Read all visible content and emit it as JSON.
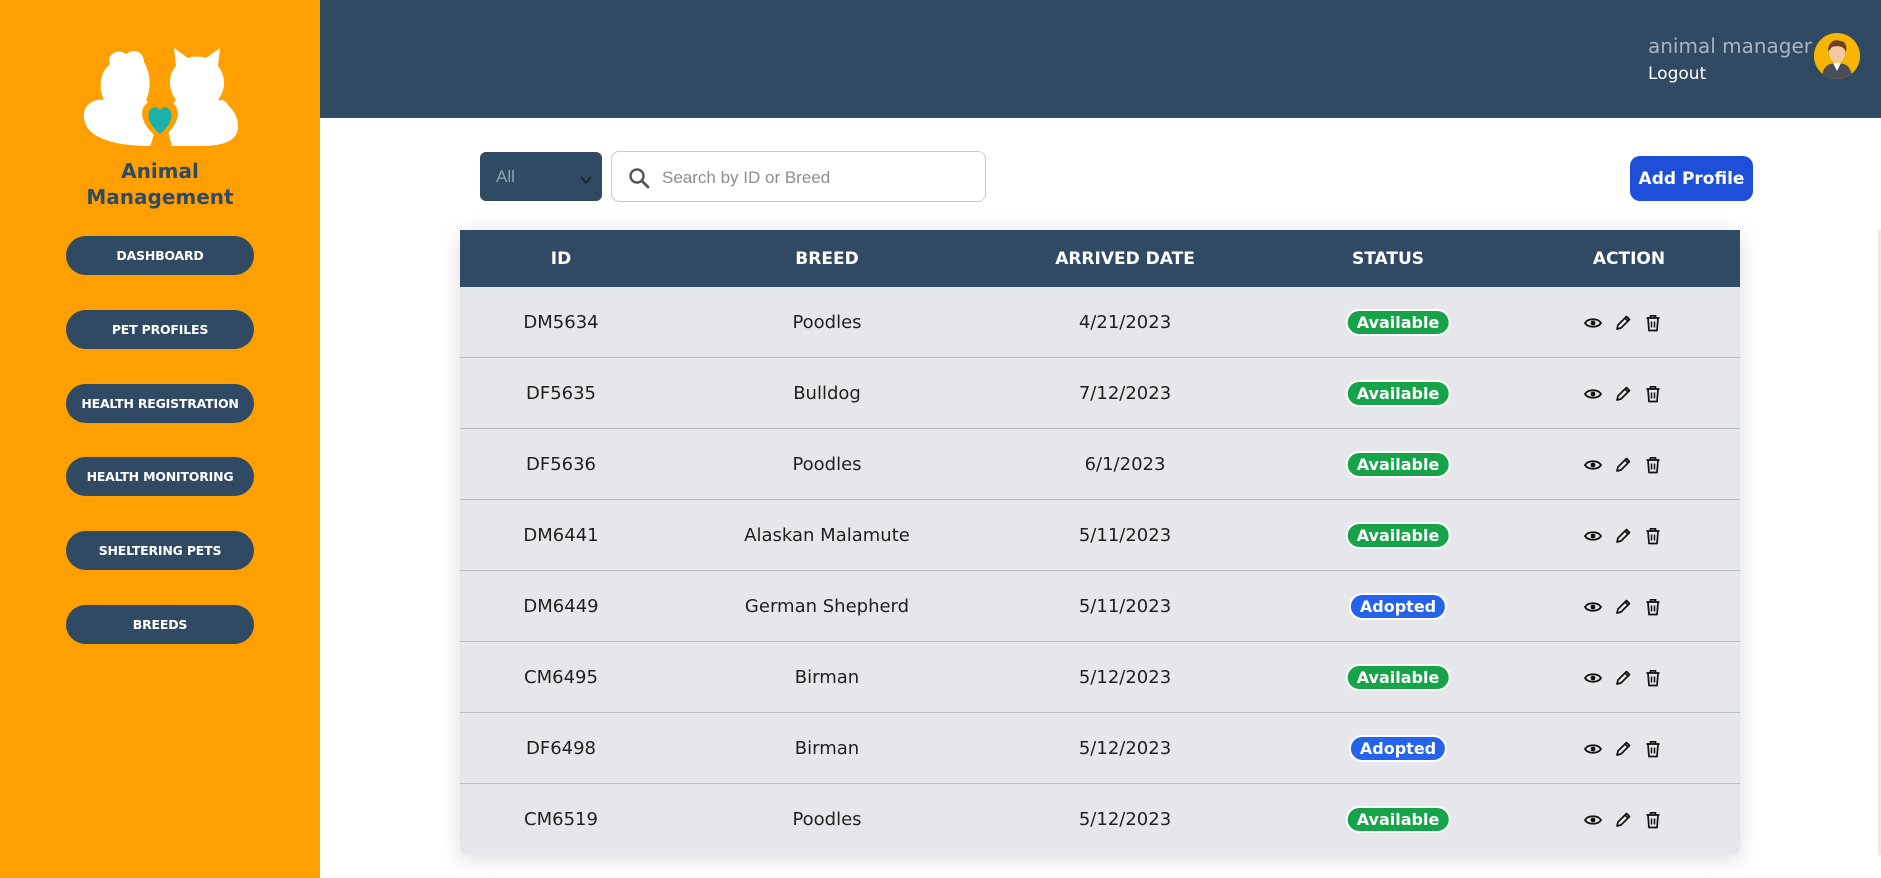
{
  "app": {
    "brand_line1": "Animal",
    "brand_line2": "Management"
  },
  "sidebar": {
    "items": [
      {
        "label": "DASHBOARD",
        "name": "sidebar-item-dashboard"
      },
      {
        "label": "PET PROFILES",
        "name": "sidebar-item-pet-profiles"
      },
      {
        "label": "HEALTH REGISTRATION",
        "name": "sidebar-item-health-registration"
      },
      {
        "label": "HEALTH MONITORING",
        "name": "sidebar-item-health-monitoring"
      },
      {
        "label": "SHELTERING PETS",
        "name": "sidebar-item-sheltering-pets"
      },
      {
        "label": "BREEDS",
        "name": "sidebar-item-breeds"
      }
    ]
  },
  "header": {
    "user_name": "animal manager",
    "logout_label": "Logout"
  },
  "toolbar": {
    "filter_value": "All",
    "search_placeholder": "Search by ID or Breed",
    "add_label": "Add Profile"
  },
  "table": {
    "columns": [
      "ID",
      "BREED",
      "ARRIVED DATE",
      "STATUS",
      "ACTION"
    ],
    "rows": [
      {
        "id": "DM5634",
        "breed": "Poodles",
        "date": "4/21/2023",
        "status": "Available"
      },
      {
        "id": "DF5635",
        "breed": "Bulldog",
        "date": "7/12/2023",
        "status": "Available"
      },
      {
        "id": "DF5636",
        "breed": "Poodles",
        "date": "6/1/2023",
        "status": "Available"
      },
      {
        "id": "DM6441",
        "breed": "Alaskan Malamute",
        "date": "5/11/2023",
        "status": "Available"
      },
      {
        "id": "DM6449",
        "breed": "German Shepherd",
        "date": "5/11/2023",
        "status": "Adopted"
      },
      {
        "id": "CM6495",
        "breed": "Birman",
        "date": "5/12/2023",
        "status": "Available"
      },
      {
        "id": "DF6498",
        "breed": "Birman",
        "date": "5/12/2023",
        "status": "Adopted"
      },
      {
        "id": "CM6519",
        "breed": "Poodles",
        "date": "5/12/2023",
        "status": "Available"
      }
    ]
  },
  "colors": {
    "sidebar_bg": "#ff9f00",
    "header_bg": "#304a63",
    "available": "#16a34a",
    "adopted": "#2563eb",
    "primary_button": "#1d4fd8"
  },
  "icons": {
    "view": "eye-icon",
    "edit": "pencil-icon",
    "delete": "trash-icon",
    "search": "search-icon"
  }
}
